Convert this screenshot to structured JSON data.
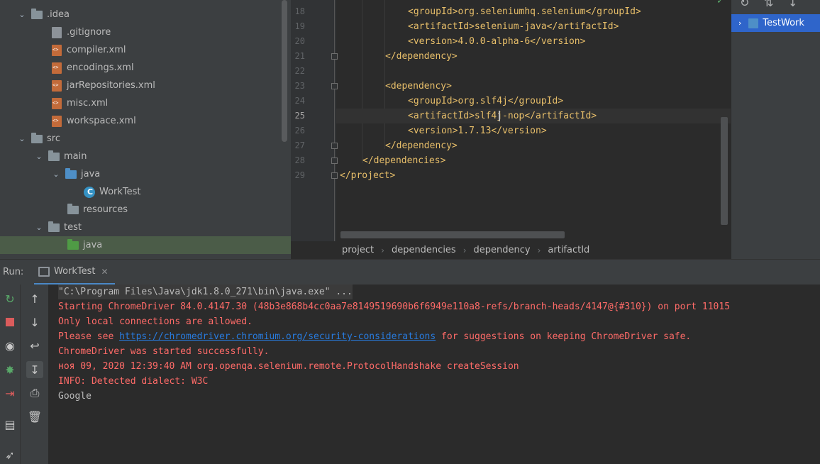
{
  "project_tree": {
    "items": [
      {
        "label": ".idea",
        "kind": "folder",
        "expanded": true
      },
      {
        "label": ".gitignore",
        "kind": "git-file"
      },
      {
        "label": "compiler.xml",
        "kind": "xml-file"
      },
      {
        "label": "encodings.xml",
        "kind": "xml-file"
      },
      {
        "label": "jarRepositories.xml",
        "kind": "xml-file"
      },
      {
        "label": "misc.xml",
        "kind": "xml-file"
      },
      {
        "label": "workspace.xml",
        "kind": "xml-file"
      },
      {
        "label": "src",
        "kind": "folder",
        "expanded": true
      },
      {
        "label": "main",
        "kind": "folder",
        "expanded": true
      },
      {
        "label": "java",
        "kind": "source-folder",
        "expanded": true
      },
      {
        "label": "WorkTest",
        "kind": "java-class"
      },
      {
        "label": "resources",
        "kind": "resources-folder"
      },
      {
        "label": "test",
        "kind": "folder",
        "expanded": true
      },
      {
        "label": "java",
        "kind": "test-folder",
        "selected": true
      }
    ]
  },
  "editor": {
    "lines": [
      {
        "num": "18",
        "text": "<groupId>org.seleniumhq.selenium</groupId>"
      },
      {
        "num": "19",
        "text": "<artifactId>selenium-java</artifactId>"
      },
      {
        "num": "20",
        "text": "<version>4.0.0-alpha-6</version>"
      },
      {
        "num": "21",
        "text": "</dependency>"
      },
      {
        "num": "22",
        "text": ""
      },
      {
        "num": "23",
        "text": "<dependency>"
      },
      {
        "num": "24",
        "text": "<groupId>org.slf4j</groupId>"
      },
      {
        "num": "25",
        "text": "<artifactId>slf4j-nop</artifactId>"
      },
      {
        "num": "26",
        "text": "<version>1.7.13</version>"
      },
      {
        "num": "27",
        "text": "</dependency>"
      },
      {
        "num": "28",
        "text": "</dependencies>"
      },
      {
        "num": "29",
        "text": "</project>"
      }
    ],
    "current_line": "25"
  },
  "breadcrumbs": [
    "project",
    "dependencies",
    "dependency",
    "artifactId"
  ],
  "right_panel": {
    "item_label": "TestWork"
  },
  "run_panel": {
    "label": "Run:",
    "tab_label": "WorkTest",
    "console": {
      "command": "\"C:\\Program Files\\Java\\jdk1.8.0_271\\bin\\java.exe\" ...",
      "line1": "Starting ChromeDriver 84.0.4147.30 (48b3e868b4cc0aa7e8149519690b6f6949e110a8-refs/branch-heads/4147@{#310}) on port 11015",
      "line2": "Only local connections are allowed.",
      "line3_prefix": "Please see ",
      "line3_link": "https://chromedriver.chromium.org/security-considerations",
      "line3_suffix": " for suggestions on keeping ChromeDriver safe.",
      "line4": "ChromeDriver was started successfully.",
      "line5": "ноя 09, 2020 12:39:40 AM org.openqa.selenium.remote.ProtocolHandshake createSession",
      "line6": "INFO: Detected dialect: W3C",
      "line7": "Google"
    }
  },
  "colors": {
    "xml_tag": "#e8bf6a",
    "error_text": "#ff6b68",
    "link": "#287bde",
    "selection": "#2f65ca"
  }
}
